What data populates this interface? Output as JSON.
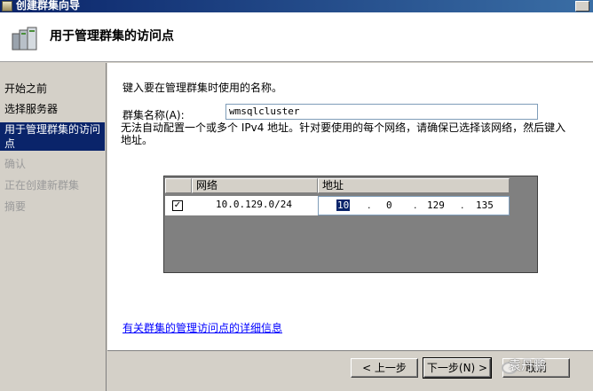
{
  "window": {
    "title": "创建群集向导"
  },
  "header": {
    "title": "用于管理群集的访问点"
  },
  "nav": {
    "items": [
      {
        "label": "开始之前"
      },
      {
        "label": "选择服务器"
      },
      {
        "label": "用于管理群集的访问点"
      },
      {
        "label": "确认"
      },
      {
        "label": "正在创建新群集"
      },
      {
        "label": "摘要"
      }
    ]
  },
  "main": {
    "instruction": "键入要在管理群集时使用的名称。",
    "name_label": "群集名称(A):",
    "name_value": "wmsqlcluster",
    "warning": "无法自动配置一个或多个 IPv4 地址。针对要使用的每个网络，请确保已选择该网络，然后键入地址。",
    "grid": {
      "col_network": "网络",
      "col_address": "地址",
      "row": {
        "checked": "✓",
        "network": "10.0.129.0/24",
        "ip": [
          "10",
          "0",
          "129",
          "135"
        ],
        "sep": "."
      }
    },
    "more_link": "有关群集的管理访问点的详细信息"
  },
  "footer": {
    "prev": "< 上一步",
    "next": "下一步(N) >",
    "cancel": "取消",
    "watermark": "袁丹鹏"
  }
}
